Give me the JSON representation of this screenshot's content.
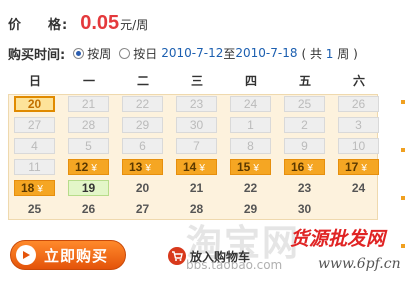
{
  "price": {
    "label_1": "价",
    "label_2": "格:",
    "value": "0.05",
    "unit": "元/周"
  },
  "period": {
    "label": "购买时间:",
    "options": [
      {
        "label": "按周",
        "checked": true
      },
      {
        "label": "按日",
        "checked": false
      }
    ],
    "start_date": "2010-7-12",
    "to_label": "至",
    "end_date": "2010-7-18",
    "total_prefix": "( 共",
    "total_num": "1",
    "total_suffix": "周 )"
  },
  "calendar": {
    "weekdays": [
      "日",
      "一",
      "二",
      "三",
      "四",
      "五",
      "六"
    ],
    "yen_symbol": "¥",
    "rows": [
      [
        {
          "d": "20",
          "s": "today"
        },
        {
          "d": "21",
          "s": "grey"
        },
        {
          "d": "22",
          "s": "grey"
        },
        {
          "d": "23",
          "s": "grey"
        },
        {
          "d": "24",
          "s": "grey"
        },
        {
          "d": "25",
          "s": "grey"
        },
        {
          "d": "26",
          "s": "grey"
        }
      ],
      [
        {
          "d": "27",
          "s": "grey"
        },
        {
          "d": "28",
          "s": "grey"
        },
        {
          "d": "29",
          "s": "grey"
        },
        {
          "d": "30",
          "s": "grey"
        },
        {
          "d": "1",
          "s": "grey"
        },
        {
          "d": "2",
          "s": "grey"
        },
        {
          "d": "3",
          "s": "grey"
        }
      ],
      [
        {
          "d": "4",
          "s": "grey"
        },
        {
          "d": "5",
          "s": "grey"
        },
        {
          "d": "6",
          "s": "grey"
        },
        {
          "d": "7",
          "s": "grey"
        },
        {
          "d": "8",
          "s": "grey"
        },
        {
          "d": "9",
          "s": "grey"
        },
        {
          "d": "10",
          "s": "grey"
        }
      ],
      [
        {
          "d": "11",
          "s": "grey"
        },
        {
          "d": "12",
          "s": "booked"
        },
        {
          "d": "13",
          "s": "booked"
        },
        {
          "d": "14",
          "s": "booked"
        },
        {
          "d": "15",
          "s": "booked"
        },
        {
          "d": "16",
          "s": "booked"
        },
        {
          "d": "17",
          "s": "booked"
        }
      ],
      [
        {
          "d": "18",
          "s": "booked"
        },
        {
          "d": "19",
          "s": "free"
        },
        {
          "d": "20",
          "s": "plain"
        },
        {
          "d": "21",
          "s": "plain"
        },
        {
          "d": "22",
          "s": "plain"
        },
        {
          "d": "23",
          "s": "plain"
        },
        {
          "d": "24",
          "s": "plain"
        }
      ],
      [
        {
          "d": "25",
          "s": "plain"
        },
        {
          "d": "26",
          "s": "plain"
        },
        {
          "d": "27",
          "s": "plain"
        },
        {
          "d": "28",
          "s": "plain"
        },
        {
          "d": "29",
          "s": "plain"
        },
        {
          "d": "30",
          "s": "plain"
        },
        {
          "d": "",
          "s": "plain"
        }
      ]
    ]
  },
  "actions": {
    "buy_label": "立即购买",
    "cart_label": "放入购物车"
  },
  "watermarks": {
    "logo": "淘宝网",
    "url": "bbs.taobao.com",
    "cn": "货源批发网",
    "site": "www.6pf.cn"
  },
  "colors": {
    "accent": "#f5a623",
    "price": "#e4393c",
    "link": "#1c5fb0"
  }
}
